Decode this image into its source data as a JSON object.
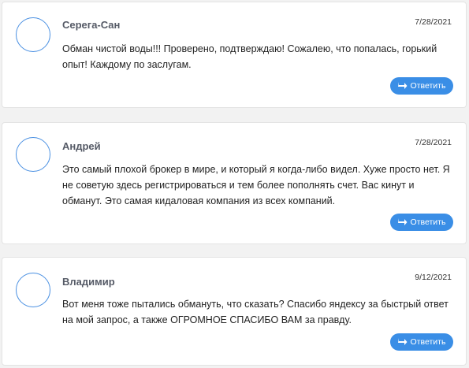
{
  "colors": {
    "accent": "#3a8ee6",
    "avatar_border": "#4a90e2",
    "name": "#555a66",
    "background": "#f2f2f2"
  },
  "comments": [
    {
      "author": "Серега-Сан",
      "date": "7/28/2021",
      "text": "Обман чистой воды!!! Проверено, подтверждаю! Сожалею, что попалась, горький опыт! Каждому по заслугам.",
      "reply_label": "Ответить",
      "reply_icon": "reply-arrow-icon"
    },
    {
      "author": "Андрей",
      "date": "7/28/2021",
      "text": "Это самый плохой брокер в мире, и который я когда-либо видел. Хуже просто нет. Я не советую здесь регистрироваться и тем более пополнять счет. Вас кинут и обманут. Это самая кидаловая компания из всех компаний.",
      "reply_label": "Ответить",
      "reply_icon": "reply-arrow-icon"
    },
    {
      "author": "Владимир",
      "date": "9/12/2021",
      "text": "Вот меня тоже пытались обмануть, что сказать? Спасибо яндексу за быстрый ответ на мой запрос, а также ОГРОМНОЕ СПАСИБО ВАМ за правду.",
      "reply_label": "Ответить",
      "reply_icon": "reply-arrow-icon"
    }
  ]
}
